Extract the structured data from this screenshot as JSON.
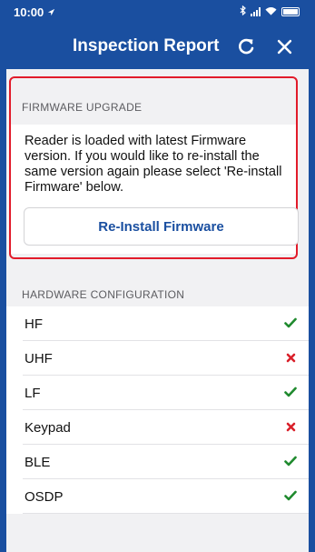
{
  "status_bar": {
    "time": "10:00",
    "location_icon": "location-arrow-icon",
    "bluetooth_icon": "bluetooth-icon",
    "wifi_icon": "wifi-icon"
  },
  "header": {
    "title": "Inspection Report",
    "refresh_icon": "refresh-icon",
    "close_icon": "close-icon"
  },
  "firmware": {
    "section_label": "FIRMWARE UPGRADE",
    "message": "Reader is loaded with latest Firmware version. If you would like to re-install the same version again please select 'Re-install Firmware' below.",
    "button_label": "Re-Install Firmware"
  },
  "hardware": {
    "section_label": "HARDWARE CONFIGURATION",
    "items": [
      {
        "name": "HF",
        "status": "ok"
      },
      {
        "name": "UHF",
        "status": "fail"
      },
      {
        "name": "LF",
        "status": "ok"
      },
      {
        "name": "Keypad",
        "status": "fail"
      },
      {
        "name": "BLE",
        "status": "ok"
      },
      {
        "name": "OSDP",
        "status": "ok"
      }
    ]
  },
  "colors": {
    "primary": "#1a4fa0",
    "highlight": "#e21b2a",
    "ok": "#1f8a2e",
    "fail": "#d9202a"
  }
}
